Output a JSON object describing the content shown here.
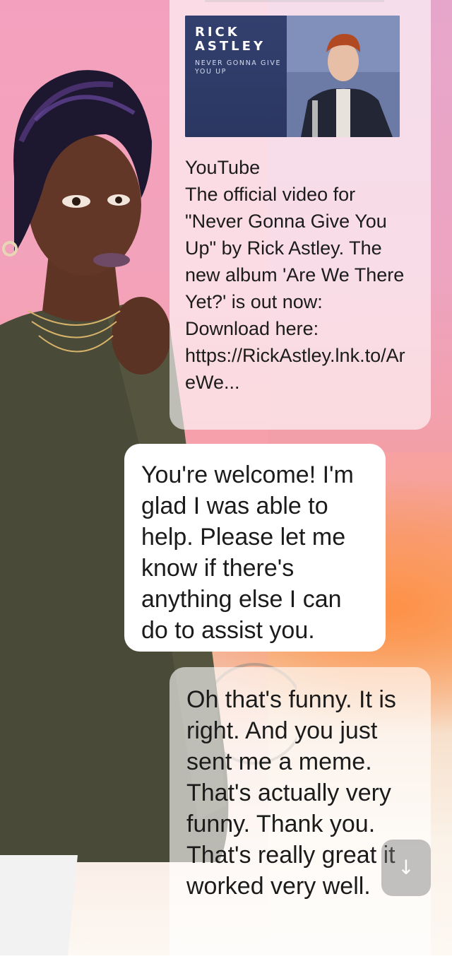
{
  "conversation": {
    "link_card": {
      "thumbnail": {
        "artist": "RICK ASTLEY",
        "song": "NEVER GONNA GIVE YOU UP"
      },
      "source": "YouTube",
      "description": "The official video for \"Never Gonna Give You Up\" by Rick Astley. The new album 'Are We There Yet?' is out now: Download here: https://RickAstley.lnk.to/AreWe..."
    },
    "reply_message": "You're welcome! I'm glad I was able to help. Please let me know if there's anything else I can do to assist you.",
    "user_message": "Oh that's funny. It is right. And you just sent me a meme. That's actually very funny. Thank you. That's really great it worked very well."
  },
  "controls": {
    "scroll_down_icon": "arrow-down-icon",
    "scroll_down_glyph": "↓"
  },
  "colors": {
    "bubble_incoming": "#ffffff9e",
    "bubble_outgoing": "#ffffff",
    "thumbnail_bg": "#2f3d6a",
    "text": "#1b1b1b"
  }
}
